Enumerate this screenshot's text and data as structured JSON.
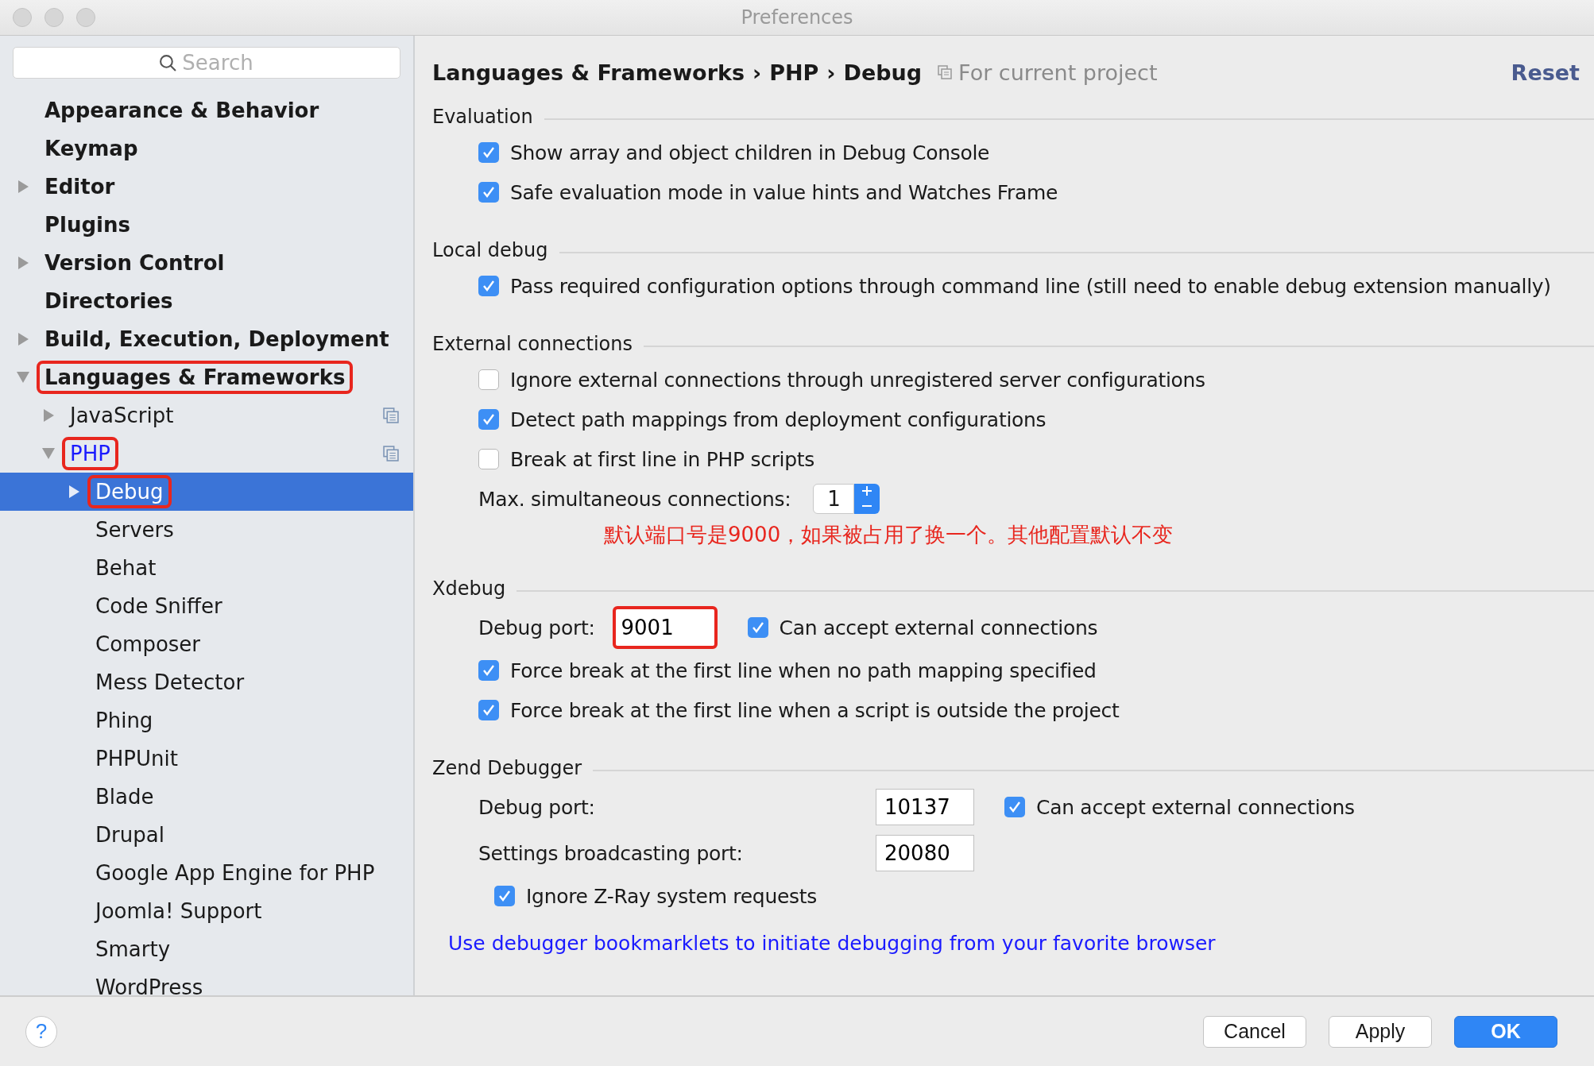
{
  "window": {
    "title": "Preferences"
  },
  "search": {
    "placeholder": "Search"
  },
  "sidebar": {
    "items": [
      {
        "label": "Appearance & Behavior",
        "selected": false,
        "modified": false,
        "annotated": false,
        "project_scope": false
      },
      {
        "label": "Keymap",
        "selected": false,
        "modified": false,
        "annotated": false,
        "project_scope": false
      },
      {
        "label": "Editor",
        "expanded": false,
        "selected": false,
        "modified": false,
        "annotated": false,
        "project_scope": false
      },
      {
        "label": "Plugins",
        "selected": false,
        "modified": false,
        "annotated": false,
        "project_scope": false
      },
      {
        "label": "Version Control",
        "expanded": false,
        "selected": false,
        "modified": false,
        "annotated": false,
        "project_scope": false
      },
      {
        "label": "Directories",
        "selected": false,
        "modified": false,
        "annotated": false,
        "project_scope": false
      },
      {
        "label": "Build, Execution, Deployment",
        "expanded": false,
        "selected": false,
        "modified": false,
        "annotated": false,
        "project_scope": false
      },
      {
        "label": "Languages & Frameworks",
        "expanded": true,
        "selected": false,
        "modified": false,
        "annotated": true,
        "project_scope": false,
        "children": [
          {
            "label": "JavaScript",
            "expanded": false,
            "selected": false,
            "modified": false,
            "annotated": false,
            "project_scope": true
          },
          {
            "label": "PHP",
            "expanded": true,
            "selected": false,
            "modified": true,
            "annotated": true,
            "project_scope": true,
            "children": [
              {
                "label": "Debug",
                "expanded": false,
                "selected": true,
                "modified": false,
                "annotated": true,
                "project_scope": false
              },
              {
                "label": "Servers",
                "selected": false,
                "modified": false,
                "annotated": false,
                "project_scope": false
              },
              {
                "label": "Behat",
                "selected": false,
                "modified": false,
                "annotated": false,
                "project_scope": false
              },
              {
                "label": "Code Sniffer",
                "selected": false,
                "modified": false,
                "annotated": false,
                "project_scope": false
              },
              {
                "label": "Composer",
                "selected": false,
                "modified": false,
                "annotated": false,
                "project_scope": false
              },
              {
                "label": "Mess Detector",
                "selected": false,
                "modified": false,
                "annotated": false,
                "project_scope": false
              },
              {
                "label": "Phing",
                "selected": false,
                "modified": false,
                "annotated": false,
                "project_scope": false
              },
              {
                "label": "PHPUnit",
                "selected": false,
                "modified": false,
                "annotated": false,
                "project_scope": false
              },
              {
                "label": "Blade",
                "selected": false,
                "modified": false,
                "annotated": false,
                "project_scope": false
              },
              {
                "label": "Drupal",
                "selected": false,
                "modified": false,
                "annotated": false,
                "project_scope": false
              },
              {
                "label": "Google App Engine for PHP",
                "selected": false,
                "modified": false,
                "annotated": false,
                "project_scope": false
              },
              {
                "label": "Joomla! Support",
                "selected": false,
                "modified": false,
                "annotated": false,
                "project_scope": false
              },
              {
                "label": "Smarty",
                "selected": false,
                "modified": false,
                "annotated": false,
                "project_scope": false
              },
              {
                "label": "WordPress",
                "selected": false,
                "modified": false,
                "annotated": false,
                "project_scope": false
              }
            ]
          }
        ]
      }
    ]
  },
  "breadcrumb": [
    {
      "kind": "crumb",
      "text": "Languages & Frameworks"
    },
    {
      "kind": "separator",
      "text": "›"
    },
    {
      "kind": "crumb",
      "text": "PHP"
    },
    {
      "kind": "separator",
      "text": "›"
    },
    {
      "kind": "crumb",
      "text": "Debug"
    }
  ],
  "scope_note": "For current project",
  "reset": "Reset",
  "sections": [
    {
      "title": "Evaluation",
      "rows": [
        {
          "kind": "checkbox",
          "label": "Show array and object children in Debug Console",
          "checked": true
        },
        {
          "kind": "checkbox",
          "label": "Safe evaluation mode in value hints and Watches Frame",
          "checked": true
        }
      ]
    },
    {
      "title": "Local debug",
      "rows": [
        {
          "kind": "checkbox",
          "label": "Pass required configuration options through command line (still need to enable debug extension manually)",
          "checked": true
        }
      ]
    },
    {
      "title": "External connections",
      "rows": [
        {
          "kind": "checkbox",
          "label": "Ignore external connections through unregistered server configurations",
          "checked": false
        },
        {
          "kind": "checkbox",
          "label": "Detect path mappings from deployment configurations",
          "checked": true
        },
        {
          "kind": "checkbox",
          "label": "Break at first line in PHP scripts",
          "checked": false
        },
        {
          "kind": "spinner",
          "label": "Max. simultaneous connections:",
          "value": "1"
        },
        {
          "kind": "note",
          "text": "默认端口号是9000，如果被占用了换一个。其他配置默认不变",
          "color": "#e8261e"
        }
      ]
    },
    {
      "title": "Xdebug",
      "rows": [
        {
          "kind": "field",
          "label": "Debug port:",
          "value": "9001",
          "annotated": true,
          "checkbox": {
            "label": "Can accept external connections",
            "checked": true
          }
        },
        {
          "kind": "checkbox",
          "label": "Force break at the first line when no path mapping specified",
          "checked": true
        },
        {
          "kind": "checkbox",
          "label": "Force break at the first line when a script is outside the project",
          "checked": true
        }
      ]
    },
    {
      "title": "Zend Debugger",
      "rows": [
        {
          "kind": "field",
          "label": "Debug port:",
          "value": "10137",
          "annotated": false,
          "checkbox": {
            "label": "Can accept external connections",
            "checked": true
          }
        },
        {
          "kind": "field",
          "label": "Settings broadcasting port:",
          "value": "20080",
          "annotated": false
        },
        {
          "kind": "subcheckbox",
          "label": "Ignore Z-Ray system requests",
          "checked": true
        }
      ]
    }
  ],
  "link": "Use debugger bookmarklets to initiate debugging from your favorite browser",
  "footer": {
    "help": "?",
    "buttons": [
      {
        "label": "Cancel",
        "default": false
      },
      {
        "label": "Apply",
        "default": false
      },
      {
        "label": "OK",
        "default": true
      }
    ]
  }
}
